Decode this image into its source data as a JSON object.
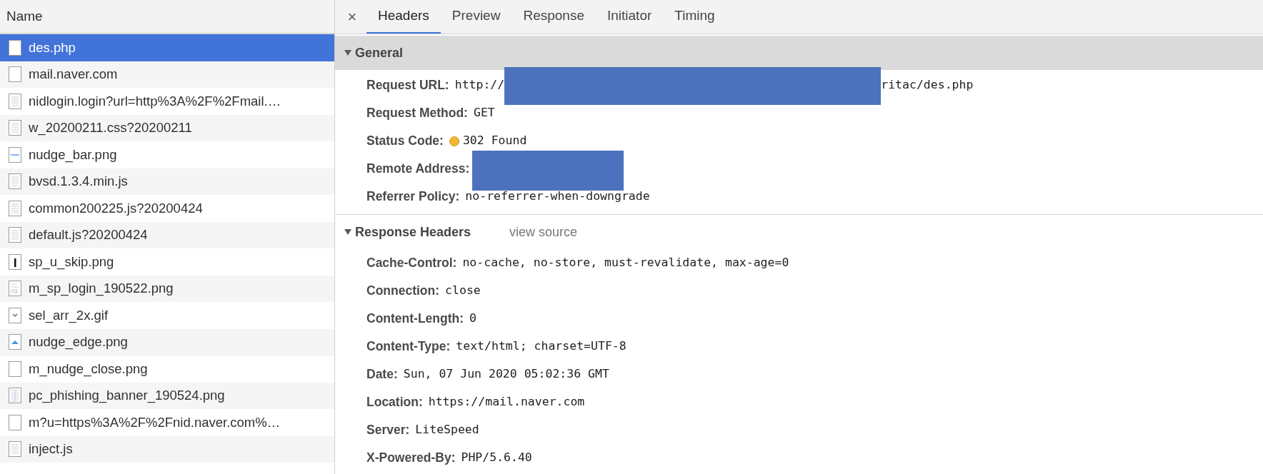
{
  "requests": {
    "column": "Name",
    "rows": [
      {
        "name": "des.php",
        "kind": "blank",
        "selected": true
      },
      {
        "name": "mail.naver.com",
        "kind": "blank",
        "selected": false
      },
      {
        "name": "nidlogin.login?url=http%3A%2F%2Fmail.…",
        "kind": "doc",
        "selected": false
      },
      {
        "name": "w_20200211.css?20200211",
        "kind": "doc",
        "selected": false
      },
      {
        "name": "nudge_bar.png",
        "kind": "bar",
        "selected": false
      },
      {
        "name": "bvsd.1.3.4.min.js",
        "kind": "doc",
        "selected": false
      },
      {
        "name": "common200225.js?20200424",
        "kind": "doc",
        "selected": false
      },
      {
        "name": "default.js?20200424",
        "kind": "doc",
        "selected": false
      },
      {
        "name": "sp_u_skip.png",
        "kind": "skip",
        "selected": false
      },
      {
        "name": "m_sp_login_190522.png",
        "kind": "login",
        "selected": false
      },
      {
        "name": "sel_arr_2x.gif",
        "kind": "chevron",
        "selected": false
      },
      {
        "name": "nudge_edge.png",
        "kind": "triangle",
        "selected": false
      },
      {
        "name": "m_nudge_close.png",
        "kind": "blank",
        "selected": false
      },
      {
        "name": "pc_phishing_banner_190524.png",
        "kind": "table",
        "selected": false
      },
      {
        "name": "m?u=https%3A%2F%2Fnid.naver.com%…",
        "kind": "blank",
        "selected": false
      },
      {
        "name": "inject.js",
        "kind": "doc",
        "selected": false
      }
    ]
  },
  "close": "×",
  "tabs": [
    {
      "label": "Headers",
      "selected": true
    },
    {
      "label": "Preview",
      "selected": false
    },
    {
      "label": "Response",
      "selected": false
    },
    {
      "label": "Initiator",
      "selected": false
    },
    {
      "label": "Timing",
      "selected": false
    }
  ],
  "general": {
    "title": "General",
    "expanded": true,
    "rows": [
      {
        "key": "Request URL:",
        "value": [
          {
            "kind": "text",
            "text": "http://"
          },
          {
            "kind": "redacted"
          },
          {
            "kind": "text",
            "text": "ritac/des.php"
          }
        ]
      },
      {
        "key": "Request Method:",
        "value": [
          {
            "kind": "text",
            "text": "GET"
          }
        ]
      },
      {
        "key": "Status Code:",
        "value": [
          {
            "kind": "status",
            "color": "#f2b632"
          },
          {
            "kind": "text",
            "text": "302 Found"
          }
        ]
      },
      {
        "key": "Remote Address:",
        "value": [
          {
            "kind": "redacted"
          }
        ]
      },
      {
        "key": "Referrer Policy:",
        "value": [
          {
            "kind": "text",
            "text": "no-referrer-when-downgrade"
          }
        ]
      }
    ]
  },
  "response_headers": {
    "title": "Response Headers",
    "expanded": true,
    "link": "view source",
    "rows": [
      {
        "key": "Cache-Control:",
        "value": "no-cache, no-store, must-revalidate, max-age=0"
      },
      {
        "key": "Connection:",
        "value": "close"
      },
      {
        "key": "Content-Length:",
        "value": "0"
      },
      {
        "key": "Content-Type:",
        "value": "text/html; charset=UTF-8"
      },
      {
        "key": "Date:",
        "value": "Sun, 07 Jun 2020 05:02:36 GMT"
      },
      {
        "key": "Location:",
        "value": "https://mail.naver.com"
      },
      {
        "key": "Server:",
        "value": "LiteSpeed"
      },
      {
        "key": "X-Powered-By:",
        "value": "PHP/5.6.40"
      }
    ]
  }
}
